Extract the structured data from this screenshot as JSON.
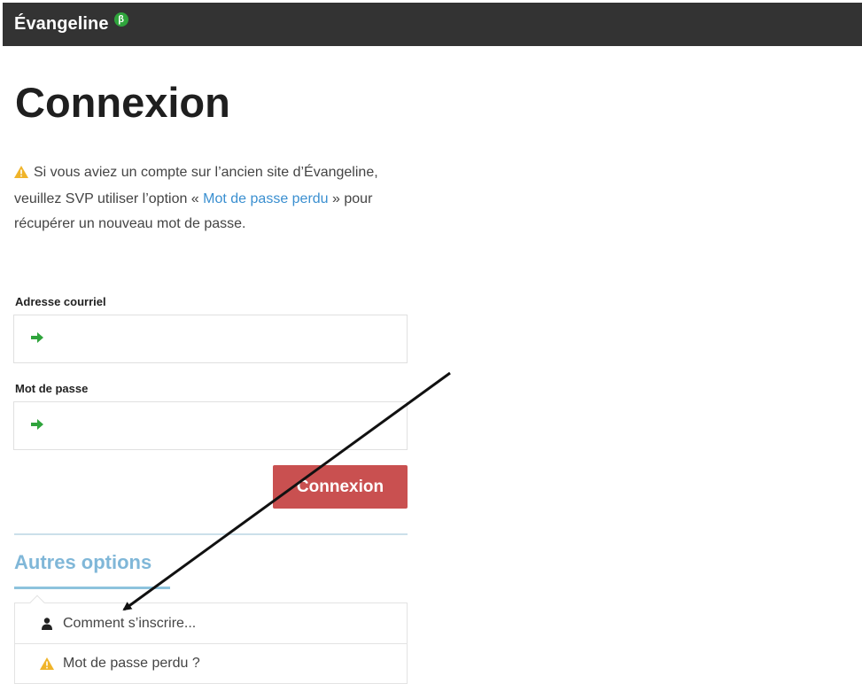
{
  "header": {
    "brand": "Évangeline",
    "badge": "β"
  },
  "page": {
    "title": "Connexion"
  },
  "notice": {
    "text_before": "Si vous aviez un compte sur l’ancien site d’Évangeline, veuillez SVP utiliser l’option « ",
    "link": "Mot de passe perdu",
    "text_after": " » pour récupérer un nouveau mot de passe."
  },
  "form": {
    "email_label": "Adresse courriel",
    "email_value": "",
    "password_label": "Mot de passe",
    "password_value": "",
    "submit_label": "Connexion"
  },
  "other_options": {
    "title": "Autres options",
    "items": [
      {
        "icon": "user-icon",
        "label": "Comment s’inscrire..."
      },
      {
        "icon": "warning-icon",
        "label": "Mot de passe perdu ?"
      }
    ]
  },
  "colors": {
    "topbar": "#333333",
    "beta_badge": "#2fa43c",
    "submit_button": "#c95050",
    "link": "#3a8fd0",
    "section_title": "#80b7d8",
    "warning": "#f0b429",
    "arrow": "#2fa43c"
  }
}
